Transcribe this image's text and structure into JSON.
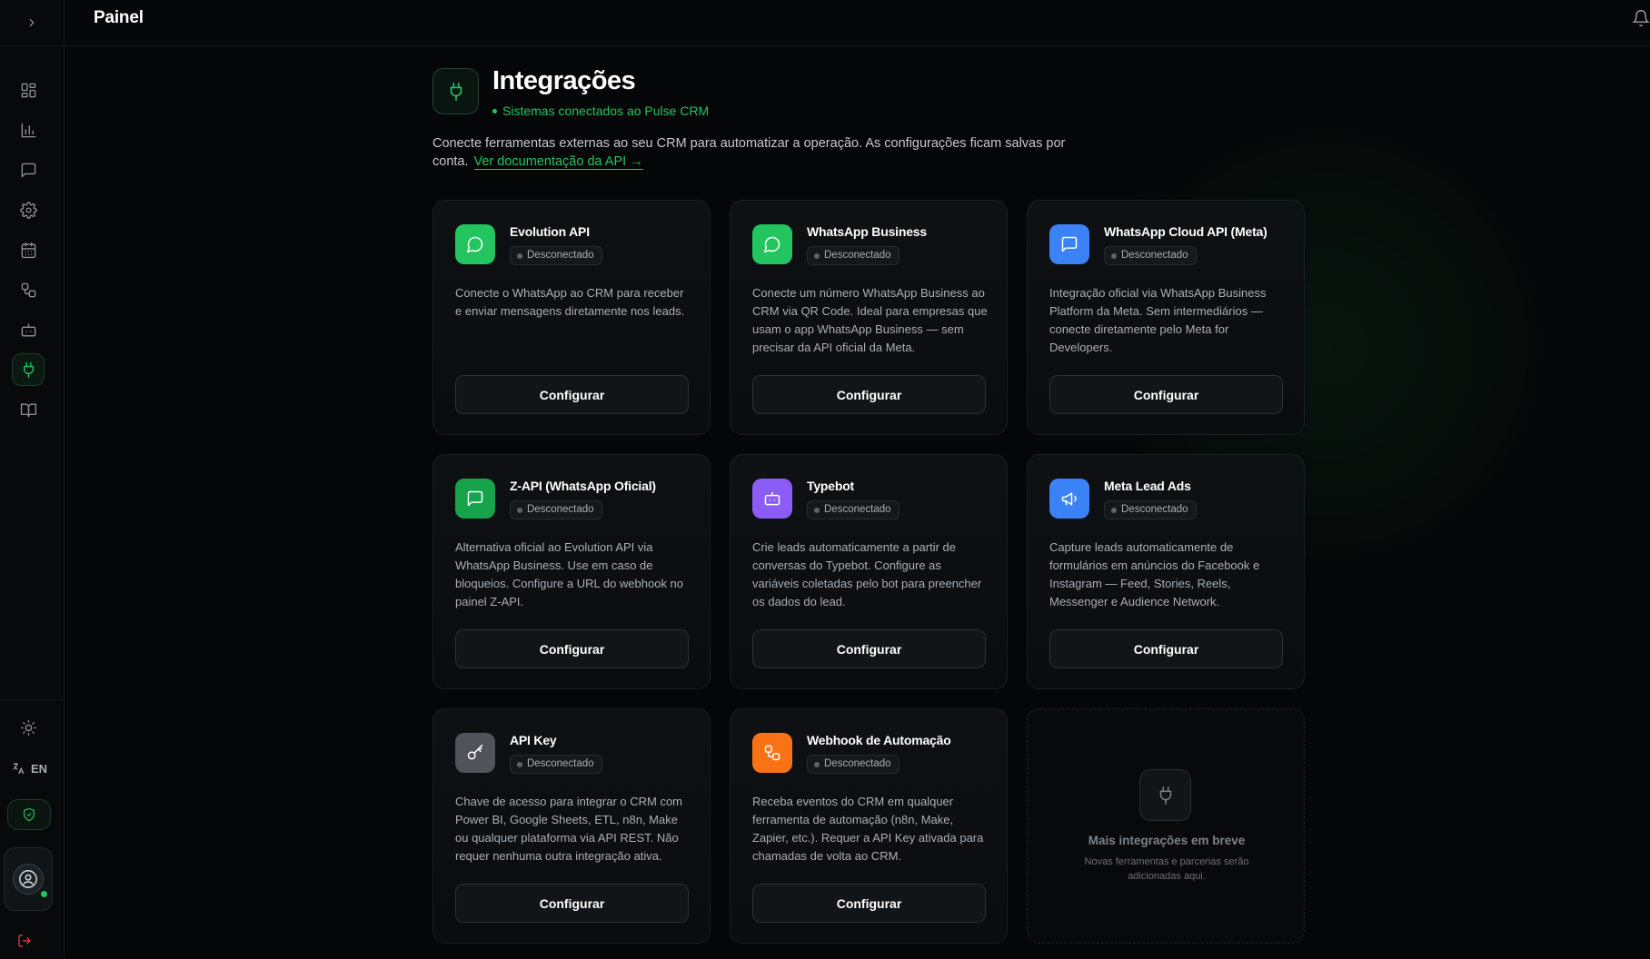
{
  "header": {
    "title": "Painel"
  },
  "sidebar": {
    "items": [
      {
        "name": "sidebar-item-dashboard",
        "icon": "grid-icon"
      },
      {
        "name": "sidebar-item-reports",
        "icon": "bar-chart-icon"
      },
      {
        "name": "sidebar-item-messages",
        "icon": "chat-icon"
      },
      {
        "name": "sidebar-item-settings",
        "icon": "gear-icon"
      },
      {
        "name": "sidebar-item-calendar",
        "icon": "calendar-icon"
      },
      {
        "name": "sidebar-item-workflows",
        "icon": "workflow-icon"
      },
      {
        "name": "sidebar-item-bots",
        "icon": "bot-icon"
      },
      {
        "name": "sidebar-item-integrations",
        "icon": "plug-icon",
        "active": true
      },
      {
        "name": "sidebar-item-docs",
        "icon": "book-icon"
      }
    ],
    "language_label": "EN"
  },
  "page": {
    "title": "Integrações",
    "subtitle": "Sistemas conectados ao Pulse CRM",
    "intro": "Conecte ferramentas externas ao seu CRM para automatizar a operação. As configurações ficam salvas por conta.",
    "doc_link": "Ver documentação da API →",
    "accent_color": "#22c55e"
  },
  "cards": [
    {
      "name": "Evolution API",
      "status": "Desconectado",
      "description": "Conecte o WhatsApp ao CRM para receber e enviar mensagens diretamente nos leads.",
      "button": "Configurar",
      "icon": "chat-bubble-icon",
      "color": "#22c55e"
    },
    {
      "name": "WhatsApp Business",
      "status": "Desconectado",
      "description": "Conecte um número WhatsApp Business ao CRM via QR Code. Ideal para empresas que usam o app WhatsApp Business — sem precisar da API oficial da Meta.",
      "button": "Configurar",
      "icon": "chat-bubble-icon",
      "color": "#22c55e"
    },
    {
      "name": "WhatsApp Cloud API (Meta)",
      "status": "Desconectado",
      "description": "Integração oficial via WhatsApp Business Platform da Meta. Sem intermediários — conecte diretamente pelo Meta for Developers.",
      "button": "Configurar",
      "icon": "message-square-icon",
      "color": "#3b82f6"
    },
    {
      "name": "Z-API (WhatsApp Oficial)",
      "status": "Desconectado",
      "description": "Alternativa oficial ao Evolution API via WhatsApp Business. Use em caso de bloqueios. Configure a URL do webhook no painel Z-API.",
      "button": "Configurar",
      "icon": "message-square-icon",
      "color": "#16a34a"
    },
    {
      "name": "Typebot",
      "status": "Desconectado",
      "description": "Crie leads automaticamente a partir de conversas do Typebot. Configure as variáveis coletadas pelo bot para preencher os dados do lead.",
      "button": "Configurar",
      "icon": "bot-icon",
      "color": "#8b5cf6"
    },
    {
      "name": "Meta Lead Ads",
      "status": "Desconectado",
      "description": "Capture leads automaticamente de formulários em anúncios do Facebook e Instagram — Feed, Stories, Reels, Messenger e Audience Network.",
      "button": "Configurar",
      "icon": "megaphone-icon",
      "color": "#3b82f6"
    },
    {
      "name": "API Key",
      "status": "Desconectado",
      "description": "Chave de acesso para integrar o CRM com Power BI, Google Sheets, ETL, n8n, Make ou qualquer plataforma via API REST. Não requer nenhuma outra integração ativa.",
      "button": "Configurar",
      "icon": "key-icon",
      "color": "#52525b"
    },
    {
      "name": "Webhook de Automação",
      "status": "Desconectado",
      "description": "Receba eventos do CRM em qualquer ferramenta de automação (n8n, Make, Zapier, etc.). Requer a API Key ativada para chamadas de volta ao CRM.",
      "button": "Configurar",
      "icon": "workflow-icon",
      "color": "#f97316"
    }
  ],
  "coming_soon": {
    "title": "Mais integrações em breve",
    "text": "Novas ferramentas e parcerias serão adicionadas aqui."
  }
}
